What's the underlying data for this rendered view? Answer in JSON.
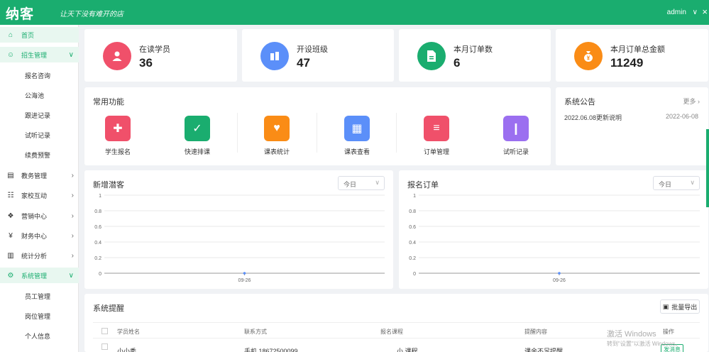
{
  "header": {
    "logo": "纳客",
    "slogan": "让天下没有难开的店",
    "user": "admin",
    "user_caret": "∨",
    "close_icon": "×"
  },
  "sidebar": {
    "items": [
      {
        "label": "首页",
        "icon": "home-icon",
        "glyph": "⌂",
        "active": true,
        "arrow": ""
      },
      {
        "label": "招生管理",
        "icon": "user-icon",
        "glyph": "☺",
        "active": false,
        "arrow": "∨"
      },
      {
        "label": "教务管理",
        "icon": "book-icon",
        "glyph": "▤",
        "active": false,
        "arrow": "›"
      },
      {
        "label": "家校互动",
        "icon": "chat-icon",
        "glyph": "☷",
        "active": false,
        "arrow": "›"
      },
      {
        "label": "营销中心",
        "icon": "gift-icon",
        "glyph": "❖",
        "active": false,
        "arrow": "›"
      },
      {
        "label": "财务中心",
        "icon": "money-icon",
        "glyph": "¥",
        "active": false,
        "arrow": "›"
      },
      {
        "label": "统计分析",
        "icon": "chart-icon",
        "glyph": "▥",
        "active": false,
        "arrow": "›"
      },
      {
        "label": "系统管理",
        "icon": "gear-icon",
        "glyph": "⚙",
        "active": true,
        "arrow": "∨"
      }
    ],
    "enroll_sub": [
      "报名咨询",
      "公海池",
      "跟进记录",
      "试听记录",
      "续费预警"
    ],
    "system_sub": [
      "员工管理",
      "岗位管理",
      "个人信息"
    ]
  },
  "stats": [
    {
      "label": "在读学员",
      "value": "36",
      "color": "#f0506a",
      "icon": "student-icon"
    },
    {
      "label": "开设班级",
      "value": "47",
      "color": "#5b8ff9",
      "icon": "building-icon"
    },
    {
      "label": "本月订单数",
      "value": "6",
      "color": "#1aad6f",
      "icon": "document-icon"
    },
    {
      "label": "本月订单总金额",
      "value": "11249",
      "color": "#fa8c16",
      "icon": "money-bag-icon"
    }
  ],
  "quick": {
    "title": "常用功能",
    "items": [
      {
        "label": "学生报名",
        "color": "#f0506a",
        "icon": "medical-kit-icon",
        "glyph": "✚"
      },
      {
        "label": "快速排课",
        "color": "#1aad6f",
        "icon": "calendar-check-icon",
        "glyph": "✓"
      },
      {
        "label": "课表统计",
        "color": "#fa8c16",
        "icon": "heart-book-icon",
        "glyph": "♥"
      },
      {
        "label": "课表查看",
        "color": "#5b8ff9",
        "icon": "calendar-icon",
        "glyph": "▦"
      },
      {
        "label": "订单管理",
        "color": "#f0506a",
        "icon": "clipboard-icon",
        "glyph": "≡"
      },
      {
        "label": "试听记录",
        "color": "#9b6ff0",
        "icon": "open-book-icon",
        "glyph": "❙"
      }
    ]
  },
  "notice": {
    "title": "系统公告",
    "more": "更多 ›",
    "item": "2022.06.08更新说明",
    "date": "2022-06-08"
  },
  "chart_left": {
    "title": "新增潜客",
    "select": "今日",
    "select_caret": "∨"
  },
  "chart_right": {
    "title": "报名订单",
    "select": "今日",
    "select_caret": "∨"
  },
  "chart_data": [
    {
      "type": "line",
      "title": "新增潜客",
      "x": [
        "09-26"
      ],
      "series": [
        {
          "values": [
            0
          ]
        }
      ],
      "ylim": [
        0,
        1
      ],
      "yticks": [
        "0",
        "0.2",
        "0.4",
        "0.6",
        "0.8",
        "1"
      ],
      "grid": true
    },
    {
      "type": "line",
      "title": "报名订单",
      "x": [
        "09-26"
      ],
      "series": [
        {
          "values": [
            0
          ]
        }
      ],
      "ylim": [
        0,
        1
      ],
      "yticks": [
        "0",
        "0.2",
        "0.4",
        "0.6",
        "0.8",
        "1"
      ],
      "grid": true
    }
  ],
  "reminder": {
    "title": "系统提醒",
    "export": "批量导出",
    "columns": [
      "学员姓名",
      "联系方式",
      "报名课程",
      "提醒内容",
      "操作"
    ],
    "row": {
      "name": "小小秀",
      "phone": "手机 18672500099",
      "course": "小 课程",
      "content": "课余不足提醒",
      "action": "发消息"
    }
  },
  "watermark": {
    "line1": "激活 Windows",
    "line2": "转到\"设置\"以激活 Windows。"
  }
}
